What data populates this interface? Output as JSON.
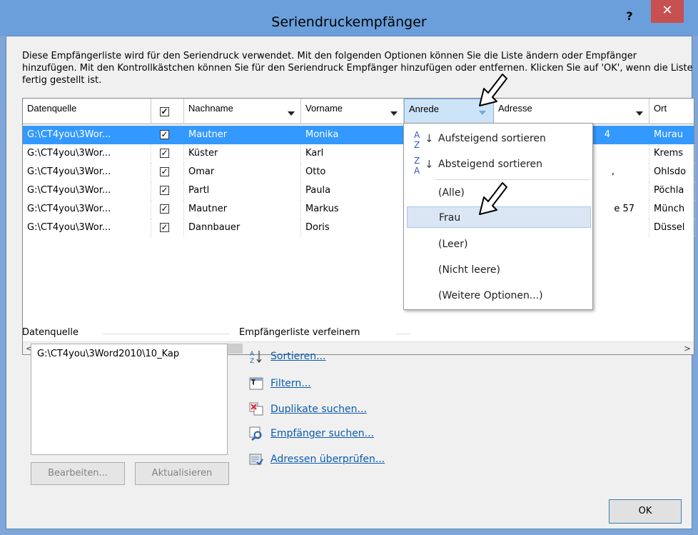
{
  "window": {
    "title": "Seriendruckempfänger",
    "help_label": "?",
    "close_label": "✕"
  },
  "intro_text": "Diese Empfängerliste wird für den Seriendruck verwendet. Mit den folgenden Optionen können Sie die Liste ändern oder Empfänger hinzufügen. Mit den Kontrollkästchen können Sie für den Seriendruck Empfänger hinzufügen oder entfernen. Klicken Sie auf 'OK', wenn die Liste fertig gestellt ist.",
  "table": {
    "headers": [
      "Datenquelle",
      "✓",
      "Nachname",
      "Vorname",
      "Anrede",
      "Adresse",
      "Ort"
    ],
    "rows": [
      {
        "source": "G:\\CT4you\\3Wor...",
        "checked": "✓",
        "nachname": "Mautner",
        "vorname": "Monika",
        "adresse": "4",
        "ort": "Murau",
        "selected": true
      },
      {
        "source": "G:\\CT4you\\3Wor...",
        "checked": "✓",
        "nachname": "Küster",
        "vorname": "Karl",
        "adresse": "",
        "ort": "Krems"
      },
      {
        "source": "G:\\CT4you\\3Wor...",
        "checked": "✓",
        "nachname": "Omar",
        "vorname": "Otto",
        "adresse": ",",
        "ort": "Ohlsdo"
      },
      {
        "source": "G:\\CT4you\\3Wor...",
        "checked": "✓",
        "nachname": "Partl",
        "vorname": "Paula",
        "adresse": "",
        "ort": "Pöchla"
      },
      {
        "source": "G:\\CT4you\\3Wor...",
        "checked": "✓",
        "nachname": "Mautner",
        "vorname": "Markus",
        "adresse": "e 57",
        "ort": "Münch"
      },
      {
        "source": "G:\\CT4you\\3Wor...",
        "checked": "✓",
        "nachname": "Dannbauer",
        "vorname": "Doris",
        "adresse": "",
        "ort": "Düssel"
      }
    ]
  },
  "dropdown": {
    "sort_asc": "Aufsteigend sortieren",
    "sort_desc": "Absteigend sortieren",
    "all": "(Alle)",
    "frau": "Frau",
    "empty": "(Leer)",
    "not_empty": "(Nicht leere)",
    "more": "(Weitere Optionen...)",
    "az_icon_top": "A",
    "az_icon_bot": "Z",
    "za_icon_top": "Z",
    "za_icon_bot": "A"
  },
  "datasource": {
    "label": "Datenquelle",
    "path": "G:\\CT4you\\3Word2010\\10_Kap"
  },
  "buttons": {
    "edit": "Bearbeiten...",
    "refresh": "Aktualisieren",
    "ok": "OK"
  },
  "refine": {
    "label": "Empfängerliste verfeinern",
    "sort": "Sortieren...",
    "filter": "Filtern...",
    "duplicates": "Duplikate suchen...",
    "find": "Empfänger suchen...",
    "validate": "Adressen überprüfen..."
  },
  "colors": {
    "selection": "#3399ff",
    "title_bar": "#6b9fdb",
    "close": "#c75050",
    "link": "#0b5cad"
  }
}
